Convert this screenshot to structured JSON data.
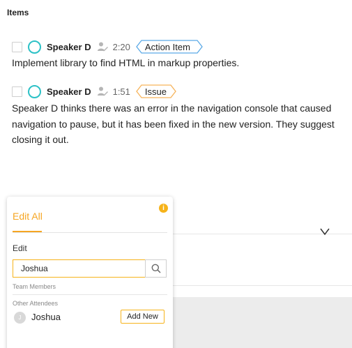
{
  "section": {
    "title": "Items"
  },
  "items": [
    {
      "speaker": "Speaker D",
      "time": "2:20",
      "tag": "Action Item",
      "tag_color": "#5aa9e6",
      "text": "Implement library to find HTML in markup properties."
    },
    {
      "speaker": "Speaker D",
      "time": "1:51",
      "tag": "Issue",
      "tag_color": "#f6b35a",
      "text": "Speaker D thinks there was an error in the navigation console that caused navigation to pause, but it has been fixed in the new version. They suggest closing it out."
    }
  ],
  "popup": {
    "tab_label": "Edit All",
    "edit_label": "Edit",
    "search_value": "Joshua",
    "team_members_label": "Team Members",
    "other_attendees_label": "Other Attendees",
    "attendee": {
      "initial": "J",
      "name": "Joshua"
    },
    "add_new_label": "Add New"
  },
  "colors": {
    "accent": "#f6a623",
    "teal": "#2cc1c6"
  }
}
